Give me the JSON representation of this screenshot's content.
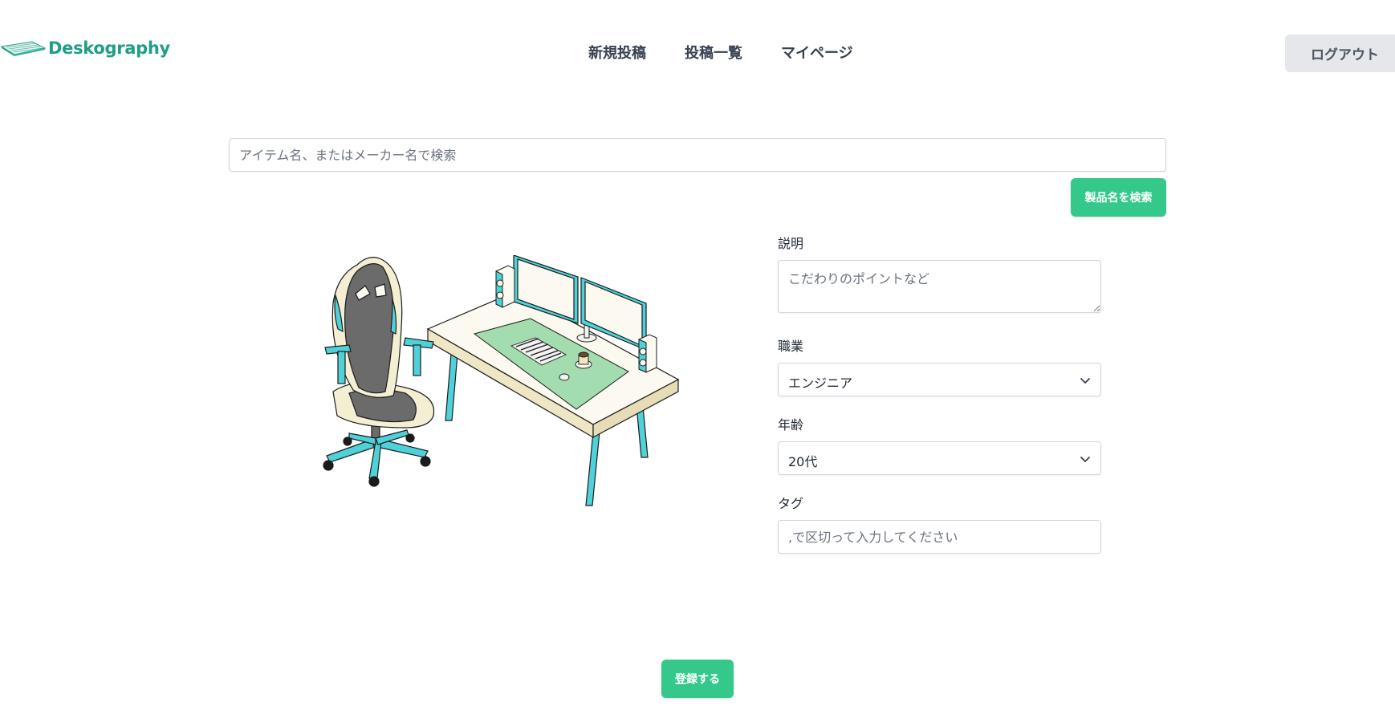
{
  "header": {
    "logo_text": "Deskography",
    "nav": [
      {
        "label": "新規投稿"
      },
      {
        "label": "投稿一覧"
      },
      {
        "label": "マイページ"
      }
    ],
    "logout_label": "ログアウト"
  },
  "search": {
    "placeholder": "アイテム名、またはメーカー名で検索",
    "button_label": "製品名を検索"
  },
  "form": {
    "description": {
      "label": "説明",
      "placeholder": "こだわりのポイントなど"
    },
    "occupation": {
      "label": "職業",
      "selected": "エンジニア"
    },
    "age": {
      "label": "年齢",
      "selected": "20代"
    },
    "tags": {
      "label": "タグ",
      "placeholder": ",で区切って入力してください"
    }
  },
  "submit_label": "登録する",
  "colors": {
    "accent": "#34c98a",
    "brand": "#1f9e86",
    "illustration_cyan": "#4fd1d9",
    "illustration_mint": "#a3dcae",
    "illustration_cream": "#f4eed3",
    "illustration_gray": "#6b6b6b"
  }
}
